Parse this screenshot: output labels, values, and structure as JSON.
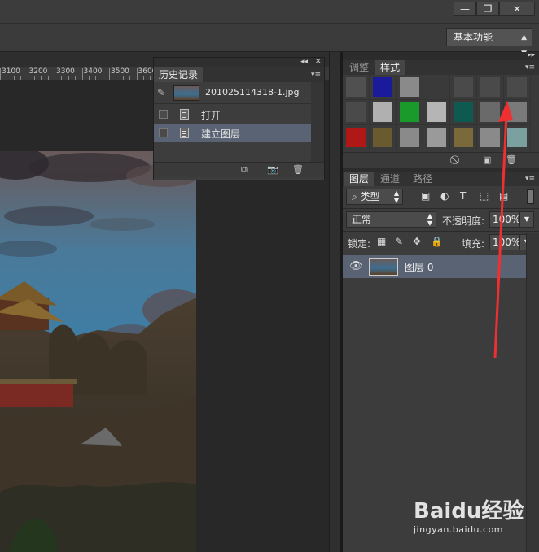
{
  "window": {
    "minimize_glyph": "—",
    "restore_glyph": "❐",
    "close_glyph": "✕"
  },
  "workspace": {
    "label": "基本功能"
  },
  "ruler": {
    "ticks": [
      "3100",
      "3200",
      "3300",
      "3400",
      "3500",
      "3600"
    ]
  },
  "history_panel": {
    "tab": "历史记录",
    "snapshot_name": "201025114318-1.jpg",
    "items": [
      {
        "label": "打开",
        "selected": false
      },
      {
        "label": "建立图层",
        "selected": true
      }
    ]
  },
  "styles_panel": {
    "tabs": [
      "调整",
      "样式"
    ],
    "active_tab": "样式",
    "swatches": [
      "#505050",
      "#1a1a9a",
      "#8a8a8a",
      "#3a3a3a",
      "#4a4a4a",
      "#4a4a4a",
      "#4a4a4a",
      "#4a4a4a",
      "#b0b0b0",
      "#1a9a2a",
      "#b5b5b5",
      "#0f5a50",
      "#6a6a6a",
      "#7a7a7a",
      "#b01818",
      "#6a5a30",
      "#8a8a8a",
      "#9a9a9a",
      "#7a6a3a",
      "#8a8a8a",
      "#7aa0a0"
    ]
  },
  "layers_panel": {
    "tabs": [
      "图层",
      "通道",
      "路径"
    ],
    "active_tab": "图层",
    "filter_label": "类型",
    "blend_mode": "正常",
    "opacity_label": "不透明度:",
    "opacity_value": "100%",
    "lock_label": "锁定:",
    "fill_label": "填充:",
    "fill_value": "100%",
    "layers": [
      {
        "name": "图层 0",
        "visible": true
      }
    ]
  },
  "watermark": {
    "logo": "Baidu经验",
    "url": "jingyan.baidu.com"
  },
  "colors": {
    "accent_arrow": "#f03030",
    "selected_row": "#596373"
  }
}
